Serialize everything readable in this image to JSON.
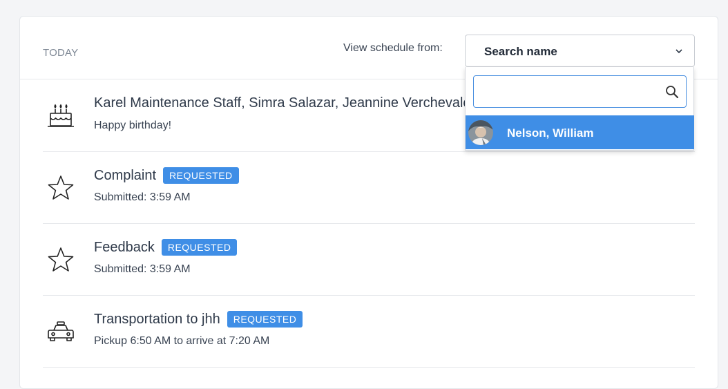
{
  "header": {
    "today_label": "TODAY",
    "view_label": "View schedule from:",
    "select_value": "Search name"
  },
  "dropdown": {
    "search_placeholder": "",
    "options": [
      {
        "label": "Nelson, William"
      }
    ]
  },
  "items": [
    {
      "icon": "birthday-cake-icon",
      "title": "Karel Maintenance Staff, Simra Salazar, Jeannine Verchevale",
      "badge": "",
      "subtitle": "Happy birthday!"
    },
    {
      "icon": "star-icon",
      "title": "Complaint",
      "badge": "REQUESTED",
      "subtitle": "Submitted: 3:59 AM"
    },
    {
      "icon": "star-icon",
      "title": "Feedback",
      "badge": "REQUESTED",
      "subtitle": "Submitted: 3:59 AM"
    },
    {
      "icon": "taxi-icon",
      "title": "Transportation to jhh",
      "badge": "REQUESTED",
      "subtitle": "Pickup 6:50 AM to arrive at 7:20 AM"
    }
  ],
  "colors": {
    "accent": "#3f8ee6",
    "border": "#e6e8eb",
    "text": "#2f3a4a"
  }
}
